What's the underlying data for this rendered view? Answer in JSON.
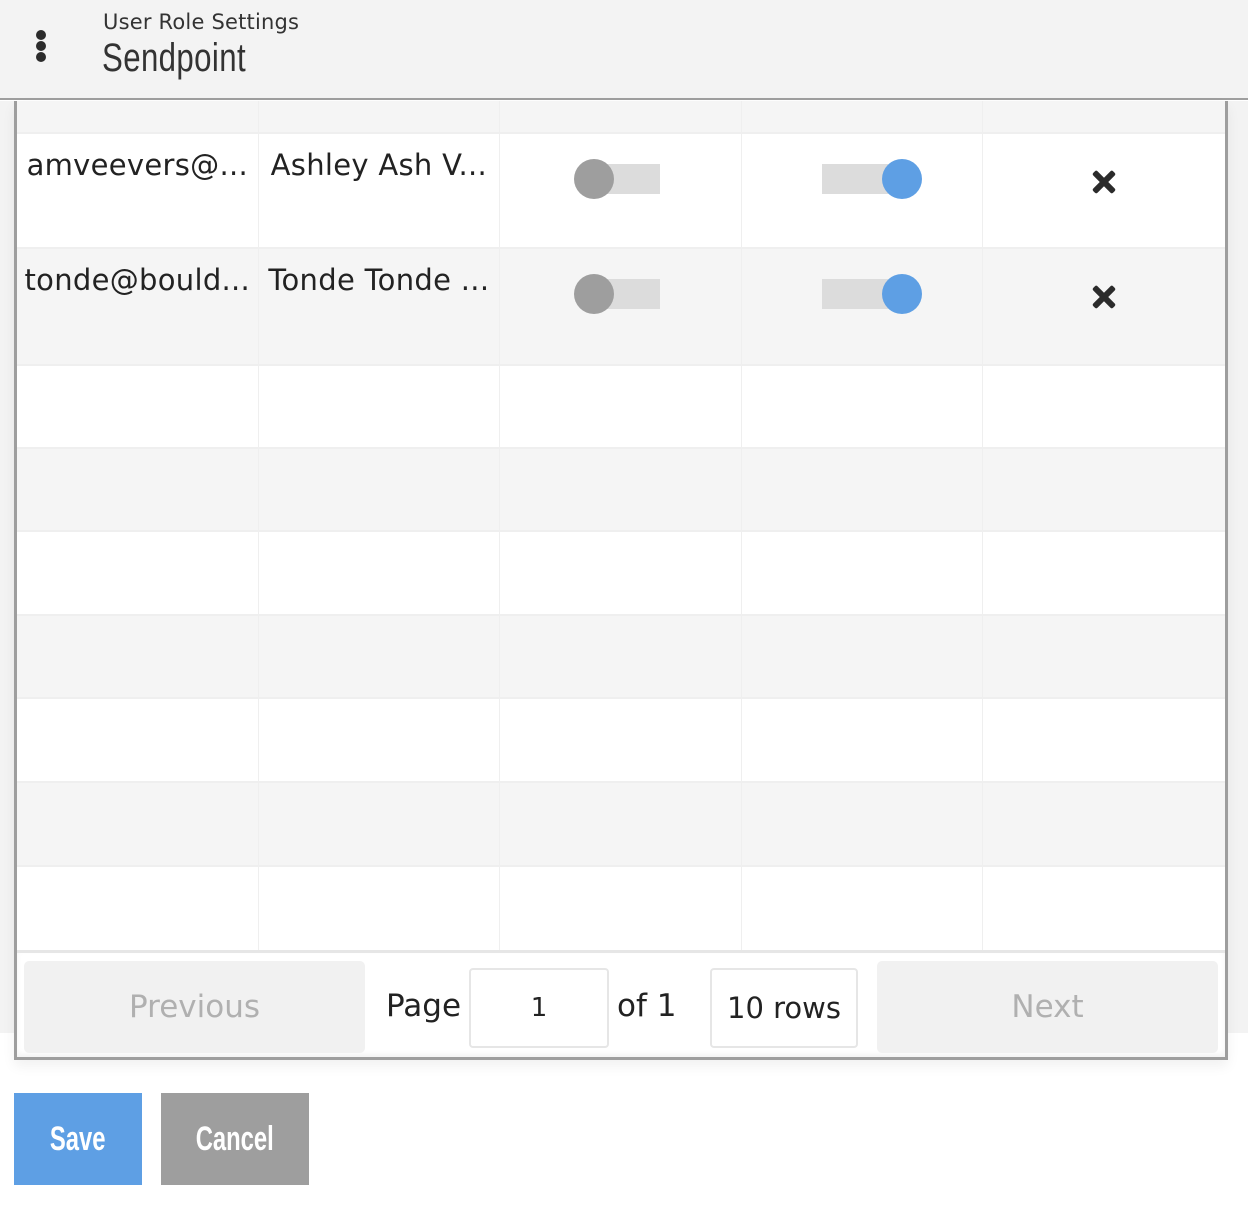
{
  "header": {
    "subtitle": "User Role Settings",
    "title": "Sendpoint",
    "menu_icon": "kebab-menu-icon"
  },
  "table": {
    "rows": [
      {
        "email": "amveevers@...",
        "name": "Ashley Ash V...",
        "toggle_a": false,
        "toggle_b": true,
        "remove_icon": "close-icon"
      },
      {
        "email": "tonde@bould...",
        "name": "Tonde Tonde ...",
        "toggle_a": false,
        "toggle_b": true,
        "remove_icon": "close-icon"
      }
    ],
    "empty_rows": 7
  },
  "pagination": {
    "previous_label": "Previous",
    "page_label": "Page",
    "page_value": "1",
    "of_label": "of 1",
    "rows_label": "10 rows",
    "next_label": "Next"
  },
  "actions": {
    "save_label": "Save",
    "cancel_label": "Cancel"
  },
  "colors": {
    "accent": "#5e9fe4",
    "toggle_off": "#9e9e9e",
    "cancel": "#9e9e9e"
  }
}
